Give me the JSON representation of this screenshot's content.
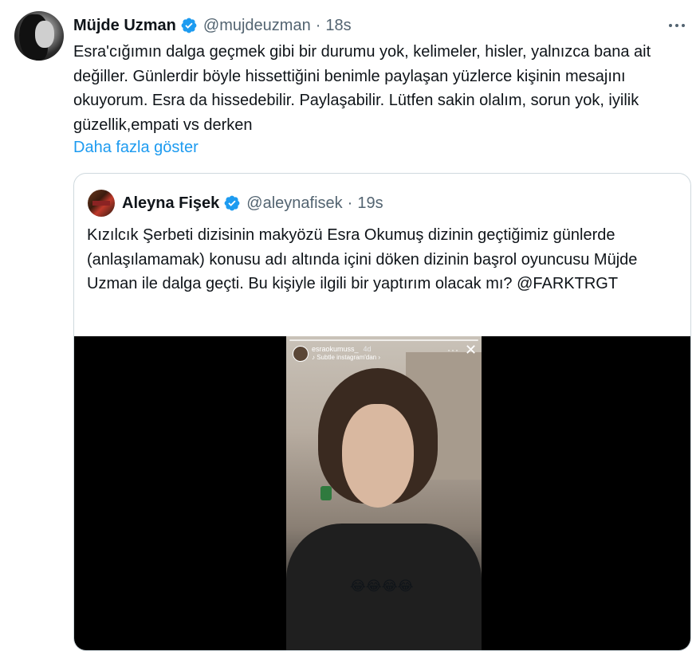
{
  "tweet": {
    "author_name": "Müjde Uzman",
    "author_handle": "@mujdeuzman",
    "separator": "·",
    "time": "18s",
    "text": "Esra'cığımın dalga geçmek gibi bir durumu yok, kelimeler, hisler, yalnızca bana ait değiller. Günlerdir böyle hissettiğini benimle paylaşan yüzlerce kişinin mesajını okuyorum. Esra da hissedebilir. Paylaşabilir. Lütfen sakin olalım, sorun yok, iyilik güzellik,empati vs derken",
    "show_more": "Daha fazla göster",
    "verified": true,
    "more_icon": "more-horizontal-icon"
  },
  "quoted": {
    "author_name": "Aleyna Fişek",
    "author_handle": "@aleynafisek",
    "separator": "·",
    "time": "19s",
    "text": "Kızılcık Şerbeti dizisinin makyözü Esra Okumuş dizinin geçtiğimiz günlerde (anlaşılamamak) konusu adı altında içini döken dizinin başrol oyuncusu Müjde Uzman ile dalga geçti. Bu kişiyle ilgili bir yaptırım olacak mı? @FARKTRGT",
    "verified": true
  },
  "story": {
    "username": "esraokumuss_",
    "age": "4d",
    "subtitle": "♪ Subtle instagram'dan ›",
    "menu": "···",
    "close": "✕",
    "emoji": "😂😂😂😂"
  },
  "colors": {
    "text": "#0f1419",
    "secondary": "#536471",
    "link": "#1d9bf0",
    "verified": "#1d9bf0",
    "border": "#cfd9de",
    "media_bg": "#000000"
  }
}
